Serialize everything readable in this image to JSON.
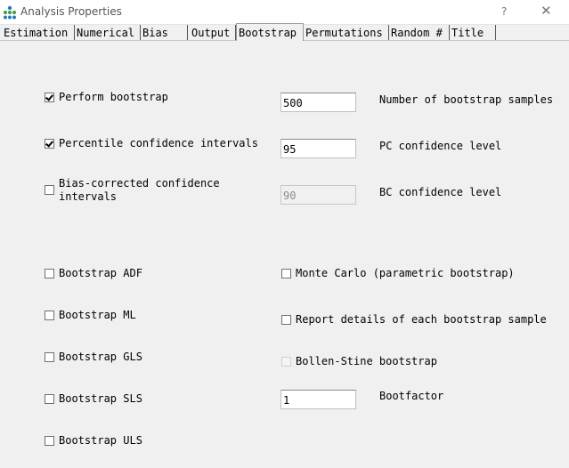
{
  "window": {
    "title": "Analysis Properties",
    "help_label": "?",
    "close_label": "✕"
  },
  "tabs": [
    {
      "label": "Estimation"
    },
    {
      "label": "Numerical"
    },
    {
      "label": "Bias"
    },
    {
      "label": "Output"
    },
    {
      "label": "Bootstrap",
      "active": true
    },
    {
      "label": "Permutations"
    },
    {
      "label": "Random #"
    },
    {
      "label": "Title"
    }
  ],
  "bootstrap": {
    "perform": {
      "label": "Perform bootstrap",
      "checked": true
    },
    "samples": {
      "value": "500",
      "label": "Number of bootstrap samples"
    },
    "percentile": {
      "label": "Percentile confidence intervals",
      "checked": true
    },
    "pc_level": {
      "value": "95",
      "label": "PC confidence level"
    },
    "bias_corrected": {
      "label_line1": "Bias-corrected confidence",
      "label_line2": "intervals",
      "checked": false
    },
    "bc_level": {
      "value": "90",
      "label": "BC confidence level",
      "disabled": true
    },
    "adf": {
      "label": "Bootstrap ADF",
      "checked": false
    },
    "monte_carlo": {
      "label": "Monte Carlo (parametric bootstrap)",
      "checked": false
    },
    "ml": {
      "label": "Bootstrap ML",
      "checked": false
    },
    "report_details": {
      "label": "Report details of each bootstrap sample",
      "checked": false
    },
    "gls": {
      "label": "Bootstrap GLS",
      "checked": false
    },
    "bollen_stine": {
      "label": "Bollen-Stine bootstrap",
      "checked": false,
      "disabled": true
    },
    "sls": {
      "label": "Bootstrap SLS",
      "checked": false
    },
    "bootfactor": {
      "value": "1",
      "label": "Bootfactor"
    },
    "uls": {
      "label": "Bootstrap ULS",
      "checked": false
    }
  }
}
